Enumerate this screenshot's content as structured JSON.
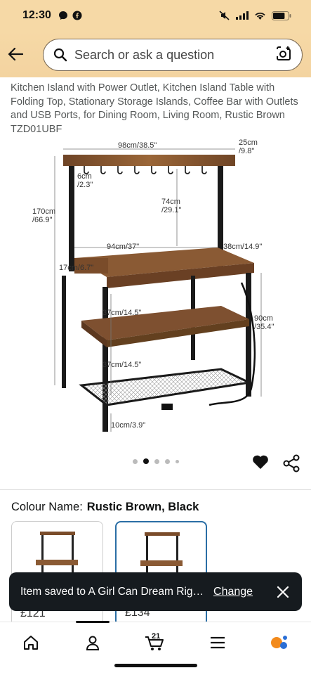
{
  "status": {
    "time": "12:30",
    "battery_level": 0.78
  },
  "search": {
    "placeholder": "Search or ask a question"
  },
  "product": {
    "title": "Kitchen Island with Power Outlet, Kitchen Island Table with Folding Top, Stationary Storage Islands, Coffee Bar with Outlets and USB Ports, for Dining Room, Living Room, Rustic Brown TZD01UBF",
    "dimensions": {
      "top_width": "98cm/38.5\"",
      "top_depth": "25cm\n/9.8\"",
      "hook_gap": "6cm\n/2.3\"",
      "shelf_height": "74cm\n/29.1\"",
      "total_height": "170cm\n/66.9\"",
      "table_width": "94cm/37\"",
      "table_depth": "38cm/14.9\"",
      "fold_width": "17cm/6.7\"",
      "level_1": "37cm/14.5\"",
      "level_2": "37cm/14.5\"",
      "table_height": "90cm\n/35.4\"",
      "bottom_gap": "10cm/3.9\""
    },
    "image_count": 5,
    "active_image": 2
  },
  "colour": {
    "label": "Colour Name:",
    "value": "Rustic Brown, Black"
  },
  "swatches": [
    {
      "price": "£121"
    },
    {
      "price": "£134"
    }
  ],
  "toast": {
    "message": "Item saved to A Girl Can Dream Rig…",
    "action": "Change"
  },
  "nav": {
    "cart_count": "21"
  },
  "colors": {
    "header_bg": "#f6d9a6",
    "toast_bg": "#161b1f",
    "accent_blue": "#2a6ea5",
    "wood": "#8a5a34"
  }
}
